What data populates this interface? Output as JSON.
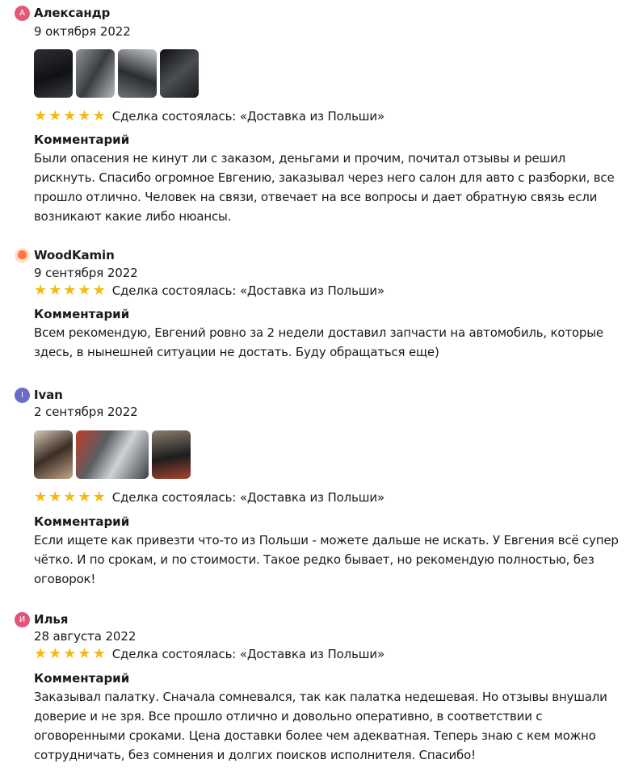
{
  "reviews": [
    {
      "avatar_letter": "А",
      "avatar_color": "#e05a74",
      "name": "Александр",
      "date": "9 октября 2022",
      "rating": 5,
      "deal": "Сделка состоялась: «Доставка из Польши»",
      "comment_title": "Комментарий",
      "comment": "Были опасения не кинут ли с заказом, деньгами и прочим, почитал отзывы и решил рискнуть. Спасибо огромное Евгению, заказывал через него салон для авто с разборки, все прошло отлично. Человек на связи, отвечает на все вопросы и дает обратную связь если возникают какие либо нюансы.",
      "photos": [
        "car-interior-photo",
        "car-seat-photo",
        "car-door-trim-photo",
        "car-interior-dark-photo"
      ]
    },
    {
      "avatar_letter": "",
      "avatar_icon": "woodkamin-logo",
      "name": "WoodKamin",
      "date": "9 сентября 2022",
      "rating": 5,
      "deal": "Сделка состоялась: «Доставка из Польши»",
      "comment_title": "Комментарий",
      "comment": "Всем рекомендую, Евгений ровно за 2 недели доставил запчасти на автомобиль, которые здесь, в нынешней ситуации не достать. Буду обращаться еще)",
      "photos": []
    },
    {
      "avatar_letter": "I",
      "avatar_color": "#6a6cc9",
      "name": "Ivan",
      "date": "2 сентября 2022",
      "rating": 5,
      "deal": "Сделка состоялась: «Доставка из Польши»",
      "comment_title": "Комментарий",
      "comment": "Если ищете как привезти что-то из Польши - можете дальше не искать. У Евгения всё супер чётко. И по срокам, и по стоимости. Такое редко бывает, но рекомендую полностью, без оговорок!",
      "photos": [
        "headlight-photo",
        "headlight-wide-photo",
        "headlight-side-photo"
      ]
    },
    {
      "avatar_letter": "И",
      "avatar_color": "#e0557a",
      "name": "Илья",
      "date": "28 августа 2022",
      "rating": 5,
      "deal": "Сделка состоялась: «Доставка из Польши»",
      "comment_title": "Комментарий",
      "comment": "Заказывал палатку. Сначала сомневался, так как палатка недешевая. Но отзывы внушали доверие и не зря. Все прошло отлично и довольно оперативно, в соответствии с оговоренными сроками. Цена доставки более чем адекватная. Теперь знаю с кем можно сотрудничать, без сомнения и долгих поисков исполнителя. Спасибо!",
      "photos": []
    }
  ],
  "colors": {
    "star": "#f5b912",
    "text": "#1a1a1a"
  }
}
